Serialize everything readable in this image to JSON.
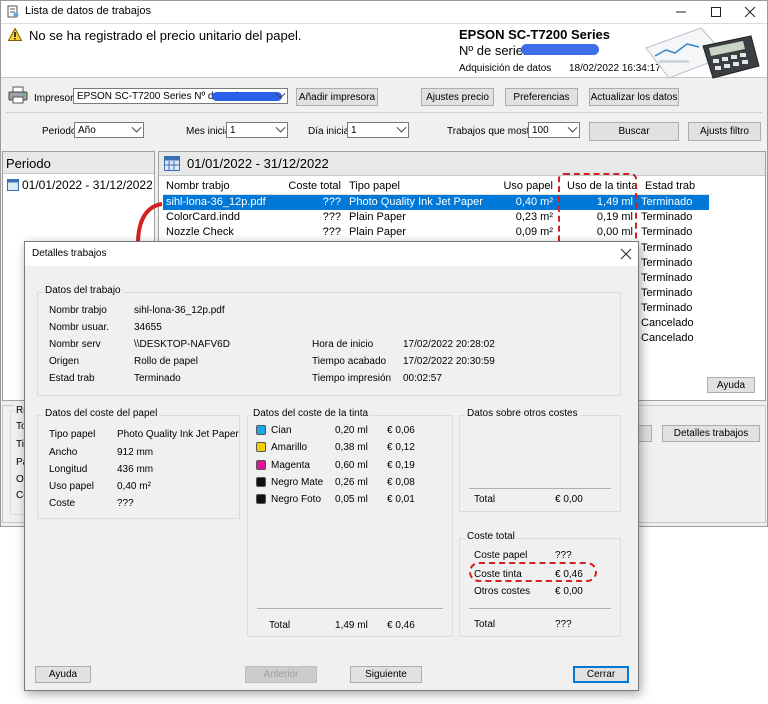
{
  "window": {
    "title": "Lista de datos de trabajos"
  },
  "warning": {
    "text": "No se ha registrado el precio unitario del papel."
  },
  "printer_info": {
    "model": "EPSON SC-T7200 Series",
    "serial_label": "Nº de serie:",
    "acquisition_label": "Adquisición de datos",
    "acquisition_value": "18/02/2022 16:34:17"
  },
  "toolbar": {
    "printer_label": "Impresora",
    "printer_value": "EPSON SC-T7200 Series Nº de serie",
    "add_printer": "Añadir impresora",
    "price_settings": "Ajustes precio",
    "preferences": "Preferencias",
    "update_data": "Actualizar los datos"
  },
  "filters": {
    "period_label": "Periodo",
    "period_value": "Año",
    "start_month_label": "Mes inicial",
    "start_month_value": "1",
    "start_day_label": "Día inicial",
    "start_day_value": "1",
    "show_jobs_label": "Trabajos que mostrar",
    "show_jobs_value": "100",
    "search": "Buscar",
    "filter_settings": "Ajusts filtro"
  },
  "period_panel": {
    "header": "Periodo",
    "item": "01/01/2022 - 31/12/2022"
  },
  "jobs_panel": {
    "header": "01/01/2022 - 31/12/2022",
    "columns": [
      "Nombr trabjo",
      "Coste total",
      "Tipo papel",
      "Uso papel",
      "Uso de la tinta",
      "Estad trab"
    ],
    "rows": [
      [
        "sihl-lona-36_12p.pdf",
        "???",
        "Photo Quality Ink Jet Paper",
        "0,40 m²",
        "1,49 ml",
        "Terminado"
      ],
      [
        "ColorCard.indd",
        "???",
        "Plain Paper",
        "0,23 m²",
        "0,19 ml",
        "Terminado"
      ],
      [
        "Nozzle Check",
        "???",
        "Plain Paper",
        "0,09 m²",
        "0,00 ml",
        "Terminado"
      ]
    ],
    "status_rest": [
      "Terminado",
      "Terminado",
      "Terminado",
      "Terminado",
      "Terminado",
      "Cancelado",
      "Cancelado"
    ],
    "help": "Ayuda",
    "job_details": "Detalles trabajos"
  },
  "back_summary": {
    "title": "Re",
    "rows": [
      "To",
      "Tir",
      "Pa",
      "Otr",
      "Co"
    ]
  },
  "dialog": {
    "title": "Detalles trabajos",
    "job_data": {
      "title": "Datos del trabajo",
      "job_name_label": "Nombr trabjo",
      "job_name": "sihl-lona-36_12p.pdf",
      "user_label": "Nombr usuar.",
      "user": "34655",
      "server_label": "Nombr serv",
      "server": "\\\\DESKTOP-NAFV6D",
      "origin_label": "Origen",
      "origin": "Rollo de papel",
      "status_label": "Estad trab",
      "status": "Terminado",
      "start_label": "Hora de inicio",
      "start": "17/02/2022 20:28:02",
      "end_label": "Tiempo acabado",
      "end": "17/02/2022 20:30:59",
      "print_time_label": "Tiempo impresión",
      "print_time": "00:02:57"
    },
    "paper_cost": {
      "title": "Datos del coste del papel",
      "type_label": "Tipo papel",
      "type": "Photo Quality Ink Jet Paper",
      "width_label": "Ancho",
      "width": "912 mm",
      "length_label": "Longitud",
      "length": "436 mm",
      "usage_label": "Uso papel",
      "usage": "0,40 m²",
      "cost_label": "Coste",
      "cost": "???"
    },
    "ink_cost": {
      "title": "Datos del coste de la tinta",
      "inks": [
        {
          "name": "Cian",
          "amount": "0,20 ml",
          "cost": "€ 0,06",
          "color": "#1aa6e8"
        },
        {
          "name": "Amarillo",
          "amount": "0,38 ml",
          "cost": "€ 0,12",
          "color": "#f5d000"
        },
        {
          "name": "Magenta",
          "amount": "0,60 ml",
          "cost": "€ 0,19",
          "color": "#e0149b"
        },
        {
          "name": "Negro Mate",
          "amount": "0,26 ml",
          "cost": "€ 0,08",
          "color": "#111111"
        },
        {
          "name": "Negro Foto",
          "amount": "0,05 ml",
          "cost": "€ 0,01",
          "color": "#111111"
        }
      ],
      "total_label": "Total",
      "total_amount": "1,49 ml",
      "total_cost": "€ 0,46"
    },
    "other_costs": {
      "title": "Datos sobre otros costes",
      "total_label": "Total",
      "total": "€ 0,00"
    },
    "total_cost": {
      "title": "Coste total",
      "paper_label": "Coste papel",
      "paper": "???",
      "ink_label": "Coste tinta",
      "ink": "€ 0,46",
      "other_label": "Otros costes",
      "other": "€ 0,00",
      "total_label": "Total",
      "total": "???"
    },
    "buttons": {
      "help": "Ayuda",
      "previous": "Anterior",
      "next": "Siguiente",
      "close": "Cerrar"
    }
  },
  "colors": {
    "selection": "#0078d7",
    "highlight": "#d42020",
    "accent_blue": "#2a5fe8"
  }
}
